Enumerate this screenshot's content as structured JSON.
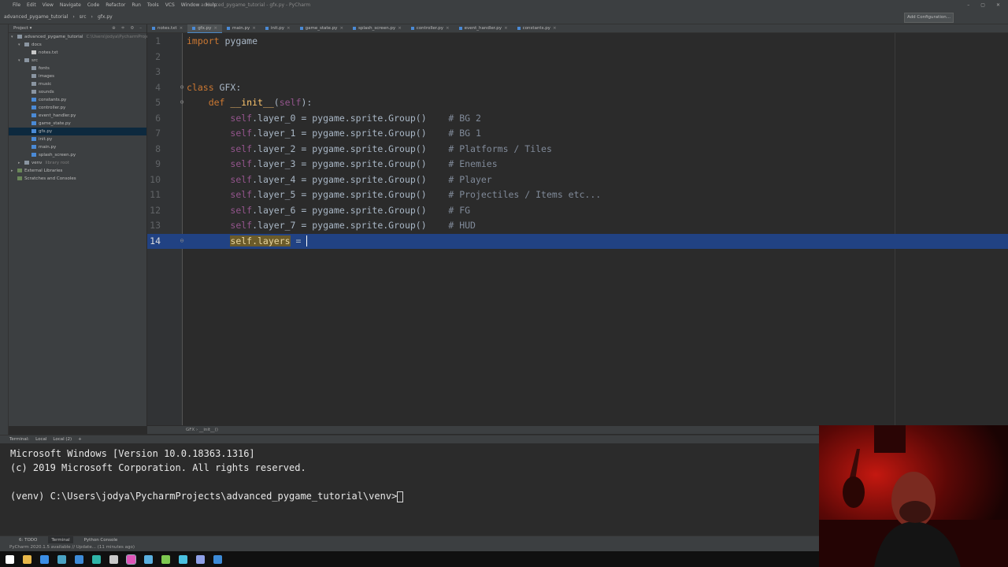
{
  "titlebar": {
    "menu": [
      "File",
      "Edit",
      "View",
      "Navigate",
      "Code",
      "Refactor",
      "Run",
      "Tools",
      "VCS",
      "Window",
      "Help"
    ],
    "window_title": "advanced_pygame_tutorial - gfx.py - PyCharm"
  },
  "navbar": {
    "crumbs": [
      "advanced_pygame_tutorial",
      "src",
      "gfx.py"
    ],
    "add_config": "Add Configuration..."
  },
  "project": {
    "header": "Project",
    "items": [
      {
        "label": "advanced_pygame_tutorial",
        "extra": "C:\\Users\\jodya\\PycharmProjects\\advanced_pygame_tutorial",
        "depth": 0,
        "icon": "folder",
        "open": true
      },
      {
        "label": "docs",
        "depth": 1,
        "icon": "folder",
        "open": true
      },
      {
        "label": "notes.txt",
        "depth": 2,
        "icon": "txtfile"
      },
      {
        "label": "src",
        "depth": 1,
        "icon": "folder",
        "open": true
      },
      {
        "label": "fonts",
        "depth": 2,
        "icon": "folder"
      },
      {
        "label": "images",
        "depth": 2,
        "icon": "folder"
      },
      {
        "label": "music",
        "depth": 2,
        "icon": "folder"
      },
      {
        "label": "sounds",
        "depth": 2,
        "icon": "folder"
      },
      {
        "label": "constants.py",
        "depth": 2,
        "icon": "pyfile"
      },
      {
        "label": "controller.py",
        "depth": 2,
        "icon": "pyfile"
      },
      {
        "label": "event_handler.py",
        "depth": 2,
        "icon": "pyfile"
      },
      {
        "label": "game_state.py",
        "depth": 2,
        "icon": "pyfile"
      },
      {
        "label": "gfx.py",
        "depth": 2,
        "icon": "pyfile",
        "selected": true
      },
      {
        "label": "init.py",
        "depth": 2,
        "icon": "pyfile"
      },
      {
        "label": "main.py",
        "depth": 2,
        "icon": "pyfile"
      },
      {
        "label": "splash_screen.py",
        "depth": 2,
        "icon": "pyfile"
      },
      {
        "label": "venv",
        "extra": "library root",
        "depth": 1,
        "icon": "folder",
        "closed": true
      },
      {
        "label": "External Libraries",
        "depth": 0,
        "icon": "libicon",
        "closed": true
      },
      {
        "label": "Scratches and Consoles",
        "depth": 0,
        "icon": "libicon"
      }
    ]
  },
  "tabs": [
    {
      "label": "notes.txt",
      "active": false
    },
    {
      "label": "gfx.py",
      "active": true
    },
    {
      "label": "main.py",
      "active": false
    },
    {
      "label": "init.py",
      "active": false
    },
    {
      "label": "game_state.py",
      "active": false
    },
    {
      "label": "splash_screen.py",
      "active": false
    },
    {
      "label": "controller.py",
      "active": false
    },
    {
      "label": "event_handler.py",
      "active": false
    },
    {
      "label": "constants.py",
      "active": false
    }
  ],
  "editor": {
    "line_numbers": [
      "1",
      "2",
      "3",
      "4",
      "5",
      "6",
      "7",
      "8",
      "9",
      "10",
      "11",
      "12",
      "13",
      "14"
    ],
    "current_line": 14,
    "lines": [
      {
        "kw": "import",
        "rest": " pygame"
      },
      {},
      {},
      {
        "kw": "class",
        "rest": " GFX:"
      },
      {
        "indent": "    ",
        "kw": "def",
        "fn": " __init__",
        "rest": "(",
        "self": "self",
        "rest2": "):"
      },
      {
        "indent": "        ",
        "self": "self",
        "rest": ".layer_0 = pygame.sprite.Group()    ",
        "comment": "# BG 2"
      },
      {
        "indent": "        ",
        "self": "self",
        "rest": ".layer_1 = pygame.sprite.Group()    ",
        "comment": "# BG 1"
      },
      {
        "indent": "        ",
        "self": "self",
        "rest": ".layer_2 = pygame.sprite.Group()    ",
        "comment": "# Platforms / Tiles"
      },
      {
        "indent": "        ",
        "self": "self",
        "rest": ".layer_3 = pygame.sprite.Group()    ",
        "comment": "# Enemies"
      },
      {
        "indent": "        ",
        "self": "self",
        "rest": ".layer_4 = pygame.sprite.Group()    ",
        "comment": "# Player"
      },
      {
        "indent": "        ",
        "self": "self",
        "rest": ".layer_5 = pygame.sprite.Group()    ",
        "comment": "# Projectiles / Items etc..."
      },
      {
        "indent": "        ",
        "self": "self",
        "rest": ".layer_6 = pygame.sprite.Group()    ",
        "comment": "# FG"
      },
      {
        "indent": "        ",
        "self": "self",
        "rest": ".layer_7 = pygame.sprite.Group()    ",
        "comment": "# HUD"
      },
      {
        "indent": "        ",
        "selfhl": "self.layers",
        "rest": " = "
      }
    ]
  },
  "breadcrumb_status": "GFX  ›  __init__()",
  "terminal": {
    "tabs": [
      "Terminal:",
      "Local",
      "Local (2)",
      "+"
    ],
    "lines": [
      "Microsoft Windows [Version 10.0.18363.1316]",
      "(c) 2019 Microsoft Corporation. All rights reserved.",
      "",
      "(venv) C:\\Users\\jodya\\PycharmProjects\\advanced_pygame_tutorial\\venv>"
    ]
  },
  "toolwindows": [
    "6: TODO",
    "Terminal",
    "Python Console"
  ],
  "ide_status": "PyCharm 2020.1.5 available // Update... (11 minutes ago)",
  "taskbar_icons": [
    "windows-start-icon",
    "file-explorer-icon",
    "chrome-icon",
    "app-icon",
    "app-icon",
    "app-icon",
    "app-icon",
    "pycharm-icon",
    "app-icon",
    "app-icon",
    "app-icon",
    "app-icon",
    "vscode-icon"
  ],
  "colors": {
    "keyword": "#cc7832",
    "self": "#94558d",
    "function": "#ffc66d",
    "comment": "#808080",
    "code": "#a9b7c6",
    "current_line": "#214283"
  }
}
